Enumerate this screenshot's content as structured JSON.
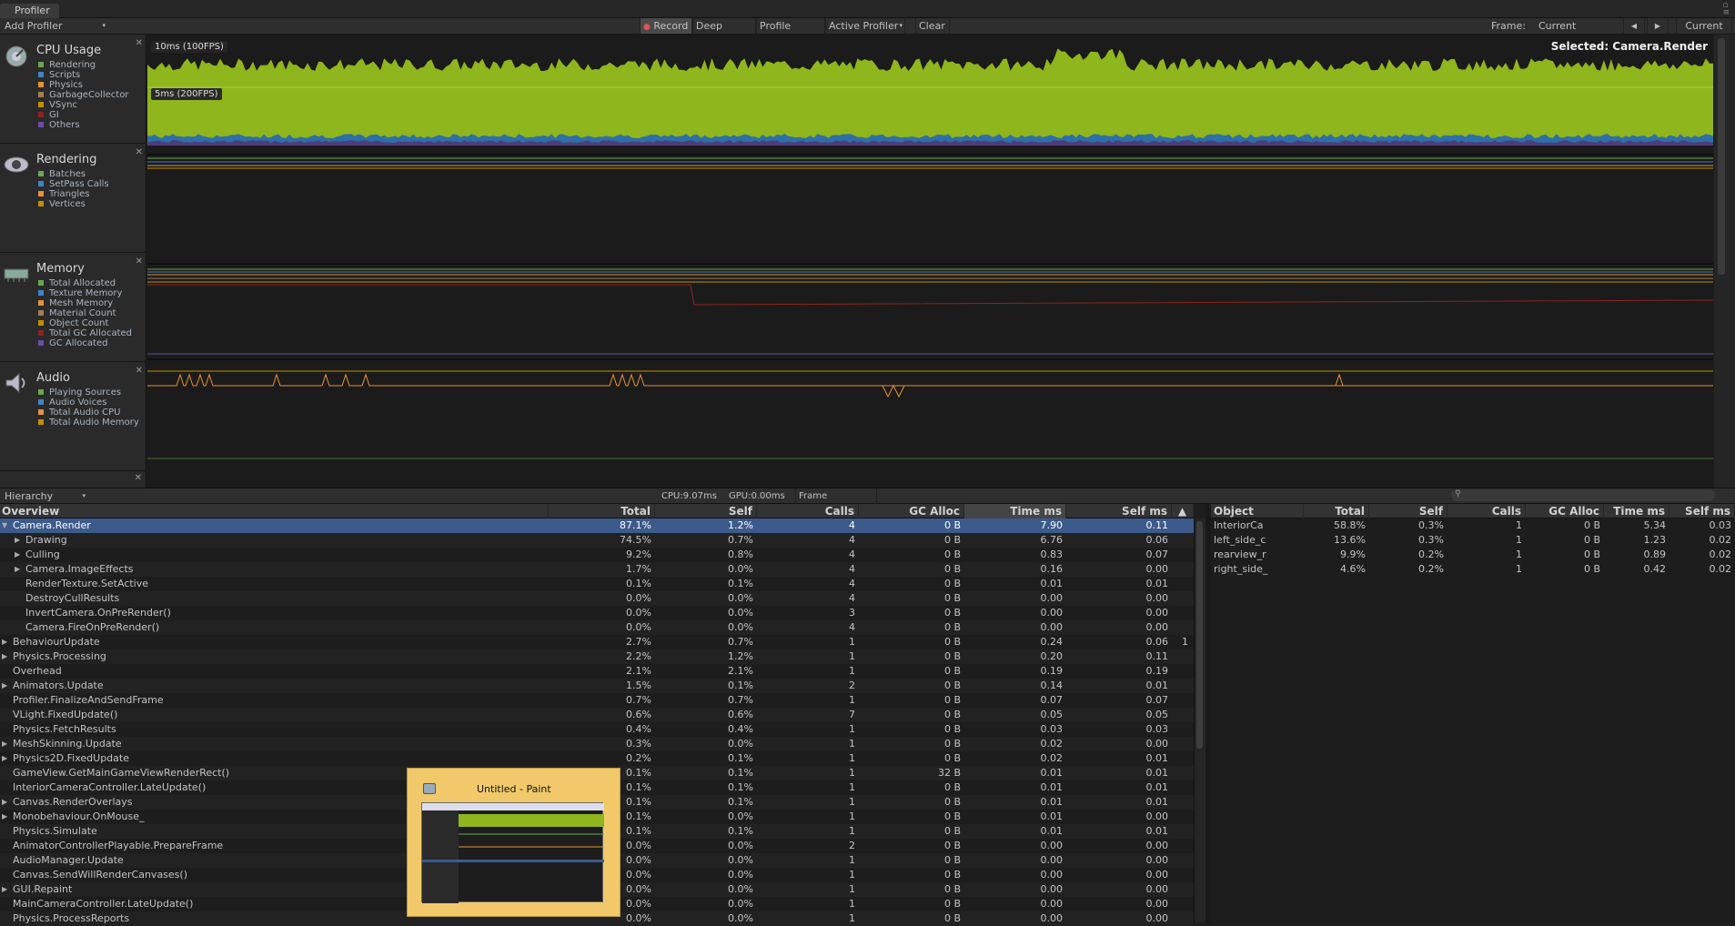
{
  "window": {
    "tab_title": "Profiler"
  },
  "toolbar": {
    "add_profiler": "Add Profiler",
    "record": "Record",
    "deep_profile": "Deep Profile",
    "profile_editor": "Profile Editor",
    "active_profiler": "Active Profiler",
    "clear": "Clear",
    "frame_label": "Frame:",
    "frame_value": "Current",
    "current_button": "Current"
  },
  "lanes": [
    {
      "title": "CPU Usage",
      "icon": "cpu-gauge-icon",
      "items": [
        {
          "label": "Rendering",
          "color": "#6aa84f"
        },
        {
          "label": "Scripts",
          "color": "#3d85c6"
        },
        {
          "label": "Physics",
          "color": "#e69138"
        },
        {
          "label": "GarbageCollector",
          "color": "#a67c52"
        },
        {
          "label": "VSync",
          "color": "#bf9000"
        },
        {
          "label": "GI",
          "color": "#8e2323"
        },
        {
          "label": "Others",
          "color": "#674ea7"
        }
      ]
    },
    {
      "title": "Rendering",
      "icon": "eye-icon",
      "items": [
        {
          "label": "Batches",
          "color": "#6aa84f"
        },
        {
          "label": "SetPass Calls",
          "color": "#3d85c6"
        },
        {
          "label": "Triangles",
          "color": "#e69138"
        },
        {
          "label": "Vertices",
          "color": "#bf9000"
        }
      ]
    },
    {
      "title": "Memory",
      "icon": "memory-chip-icon",
      "items": [
        {
          "label": "Total Allocated",
          "color": "#6aa84f"
        },
        {
          "label": "Texture Memory",
          "color": "#3d85c6"
        },
        {
          "label": "Mesh Memory",
          "color": "#e69138"
        },
        {
          "label": "Material Count",
          "color": "#a67c52"
        },
        {
          "label": "Object Count",
          "color": "#bf9000"
        },
        {
          "label": "Total GC Allocated",
          "color": "#8e2323"
        },
        {
          "label": "GC Allocated",
          "color": "#674ea7"
        }
      ]
    },
    {
      "title": "Audio",
      "icon": "speaker-icon",
      "items": [
        {
          "label": "Playing Sources",
          "color": "#6aa84f"
        },
        {
          "label": "Audio Voices",
          "color": "#3d85c6"
        },
        {
          "label": "Total Audio CPU",
          "color": "#e69138"
        },
        {
          "label": "Total Audio Memory",
          "color": "#bf9000"
        }
      ]
    }
  ],
  "graph": {
    "label_10ms": "10ms (100FPS)",
    "label_5ms": "5ms (200FPS)",
    "selected": "Selected: Camera.Render",
    "cpu_color": "#8fb61c"
  },
  "bottom": {
    "view_mode": "Hierarchy",
    "cpu_time": "CPU:9.07ms",
    "gpu_time": "GPU:0.00ms",
    "frame_debugger": "Frame Debugger"
  },
  "hierarchy": {
    "columns": [
      "Overview",
      "Total",
      "Self",
      "Calls",
      "GC Alloc",
      "Time ms",
      "Self ms"
    ],
    "rows": [
      {
        "name": "Camera.Render",
        "indent": 0,
        "arrow": "down",
        "total": "87.1%",
        "self": "1.2%",
        "calls": "4",
        "gc": "0 B",
        "time": "7.90",
        "selfms": "0.11",
        "extra": ""
      },
      {
        "name": "Drawing",
        "indent": 1,
        "arrow": "right",
        "total": "74.5%",
        "self": "0.7%",
        "calls": "4",
        "gc": "0 B",
        "time": "6.76",
        "selfms": "0.06",
        "extra": ""
      },
      {
        "name": "Culling",
        "indent": 1,
        "arrow": "right",
        "total": "9.2%",
        "self": "0.8%",
        "calls": "4",
        "gc": "0 B",
        "time": "0.83",
        "selfms": "0.07",
        "extra": ""
      },
      {
        "name": "Camera.ImageEffects",
        "indent": 1,
        "arrow": "right",
        "total": "1.7%",
        "self": "0.0%",
        "calls": "4",
        "gc": "0 B",
        "time": "0.16",
        "selfms": "0.00",
        "extra": ""
      },
      {
        "name": "RenderTexture.SetActive",
        "indent": 1,
        "arrow": "",
        "total": "0.1%",
        "self": "0.1%",
        "calls": "4",
        "gc": "0 B",
        "time": "0.01",
        "selfms": "0.01",
        "extra": ""
      },
      {
        "name": "DestroyCullResults",
        "indent": 1,
        "arrow": "",
        "total": "0.0%",
        "self": "0.0%",
        "calls": "4",
        "gc": "0 B",
        "time": "0.00",
        "selfms": "0.00",
        "extra": ""
      },
      {
        "name": "InvertCamera.OnPreRender()",
        "indent": 1,
        "arrow": "",
        "total": "0.0%",
        "self": "0.0%",
        "calls": "3",
        "gc": "0 B",
        "time": "0.00",
        "selfms": "0.00",
        "extra": ""
      },
      {
        "name": "Camera.FireOnPreRender()",
        "indent": 1,
        "arrow": "",
        "total": "0.0%",
        "self": "0.0%",
        "calls": "4",
        "gc": "0 B",
        "time": "0.00",
        "selfms": "0.00",
        "extra": ""
      },
      {
        "name": "BehaviourUpdate",
        "indent": 0,
        "arrow": "right",
        "total": "2.7%",
        "self": "0.7%",
        "calls": "1",
        "gc": "0 B",
        "time": "0.24",
        "selfms": "0.06",
        "extra": "1"
      },
      {
        "name": "Physics.Processing",
        "indent": 0,
        "arrow": "right",
        "total": "2.2%",
        "self": "1.2%",
        "calls": "1",
        "gc": "0 B",
        "time": "0.20",
        "selfms": "0.11",
        "extra": ""
      },
      {
        "name": "Overhead",
        "indent": 0,
        "arrow": "",
        "total": "2.1%",
        "self": "2.1%",
        "calls": "1",
        "gc": "0 B",
        "time": "0.19",
        "selfms": "0.19",
        "extra": ""
      },
      {
        "name": "Animators.Update",
        "indent": 0,
        "arrow": "right",
        "total": "1.5%",
        "self": "0.1%",
        "calls": "2",
        "gc": "0 B",
        "time": "0.14",
        "selfms": "0.01",
        "extra": ""
      },
      {
        "name": "Profiler.FinalizeAndSendFrame",
        "indent": 0,
        "arrow": "",
        "total": "0.7%",
        "self": "0.7%",
        "calls": "1",
        "gc": "0 B",
        "time": "0.07",
        "selfms": "0.07",
        "extra": ""
      },
      {
        "name": "VLight.FixedUpdate()",
        "indent": 0,
        "arrow": "",
        "total": "0.6%",
        "self": "0.6%",
        "calls": "7",
        "gc": "0 B",
        "time": "0.05",
        "selfms": "0.05",
        "extra": ""
      },
      {
        "name": "Physics.FetchResults",
        "indent": 0,
        "arrow": "",
        "total": "0.4%",
        "self": "0.4%",
        "calls": "1",
        "gc": "0 B",
        "time": "0.03",
        "selfms": "0.03",
        "extra": ""
      },
      {
        "name": "MeshSkinning.Update",
        "indent": 0,
        "arrow": "right",
        "total": "0.3%",
        "self": "0.0%",
        "calls": "1",
        "gc": "0 B",
        "time": "0.02",
        "selfms": "0.00",
        "extra": ""
      },
      {
        "name": "Physics2D.FixedUpdate",
        "indent": 0,
        "arrow": "right",
        "total": "0.2%",
        "self": "0.1%",
        "calls": "1",
        "gc": "0 B",
        "time": "0.02",
        "selfms": "0.01",
        "extra": ""
      },
      {
        "name": "GameView.GetMainGameViewRenderRect()",
        "indent": 0,
        "arrow": "",
        "total": "0.1%",
        "self": "0.1%",
        "calls": "1",
        "gc": "32 B",
        "time": "0.01",
        "selfms": "0.01",
        "extra": ""
      },
      {
        "name": "InteriorCameraController.LateUpdate()",
        "indent": 0,
        "arrow": "",
        "total": "0.1%",
        "self": "0.1%",
        "calls": "1",
        "gc": "0 B",
        "time": "0.01",
        "selfms": "0.01",
        "extra": ""
      },
      {
        "name": "Canvas.RenderOverlays",
        "indent": 0,
        "arrow": "right",
        "total": "0.1%",
        "self": "0.1%",
        "calls": "1",
        "gc": "0 B",
        "time": "0.01",
        "selfms": "0.01",
        "extra": ""
      },
      {
        "name": "Monobehaviour.OnMouse_",
        "indent": 0,
        "arrow": "right",
        "total": "0.1%",
        "self": "0.0%",
        "calls": "1",
        "gc": "0 B",
        "time": "0.01",
        "selfms": "0.00",
        "extra": ""
      },
      {
        "name": "Physics.Simulate",
        "indent": 0,
        "arrow": "",
        "total": "0.1%",
        "self": "0.1%",
        "calls": "1",
        "gc": "0 B",
        "time": "0.01",
        "selfms": "0.01",
        "extra": ""
      },
      {
        "name": "AnimatorControllerPlayable.PrepareFrame",
        "indent": 0,
        "arrow": "",
        "total": "0.0%",
        "self": "0.0%",
        "calls": "2",
        "gc": "0 B",
        "time": "0.00",
        "selfms": "0.00",
        "extra": ""
      },
      {
        "name": "AudioManager.Update",
        "indent": 0,
        "arrow": "",
        "total": "0.0%",
        "self": "0.0%",
        "calls": "1",
        "gc": "0 B",
        "time": "0.00",
        "selfms": "0.00",
        "extra": ""
      },
      {
        "name": "Canvas.SendWillRenderCanvases()",
        "indent": 0,
        "arrow": "",
        "total": "0.0%",
        "self": "0.0%",
        "calls": "1",
        "gc": "0 B",
        "time": "0.00",
        "selfms": "0.00",
        "extra": ""
      },
      {
        "name": "GUI.Repaint",
        "indent": 0,
        "arrow": "right",
        "total": "0.0%",
        "self": "0.0%",
        "calls": "1",
        "gc": "0 B",
        "time": "0.00",
        "selfms": "0.00",
        "extra": ""
      },
      {
        "name": "MainCameraController.LateUpdate()",
        "indent": 0,
        "arrow": "",
        "total": "0.0%",
        "self": "0.0%",
        "calls": "1",
        "gc": "0 B",
        "time": "0.00",
        "selfms": "0.00",
        "extra": ""
      },
      {
        "name": "Physics.ProcessReports",
        "indent": 0,
        "arrow": "",
        "total": "0.0%",
        "self": "0.0%",
        "calls": "1",
        "gc": "0 B",
        "time": "0.00",
        "selfms": "0.00",
        "extra": ""
      }
    ]
  },
  "objects": {
    "columns": [
      "Object",
      "Total",
      "Self",
      "Calls",
      "GC Alloc",
      "Time ms",
      "Self ms"
    ],
    "rows": [
      {
        "name": "InteriorCa",
        "total": "58.8%",
        "self": "0.3%",
        "calls": "1",
        "gc": "0 B",
        "time": "5.34",
        "selfms": "0.03"
      },
      {
        "name": "left_side_c",
        "total": "13.6%",
        "self": "0.3%",
        "calls": "1",
        "gc": "0 B",
        "time": "1.23",
        "selfms": "0.02"
      },
      {
        "name": "rearview_r",
        "total": "9.9%",
        "self": "0.2%",
        "calls": "1",
        "gc": "0 B",
        "time": "0.89",
        "selfms": "0.02"
      },
      {
        "name": "right_side_",
        "total": "4.6%",
        "self": "0.2%",
        "calls": "1",
        "gc": "0 B",
        "time": "0.42",
        "selfms": "0.02"
      }
    ]
  },
  "taskbar_preview": {
    "title": "Untitled - Paint"
  }
}
